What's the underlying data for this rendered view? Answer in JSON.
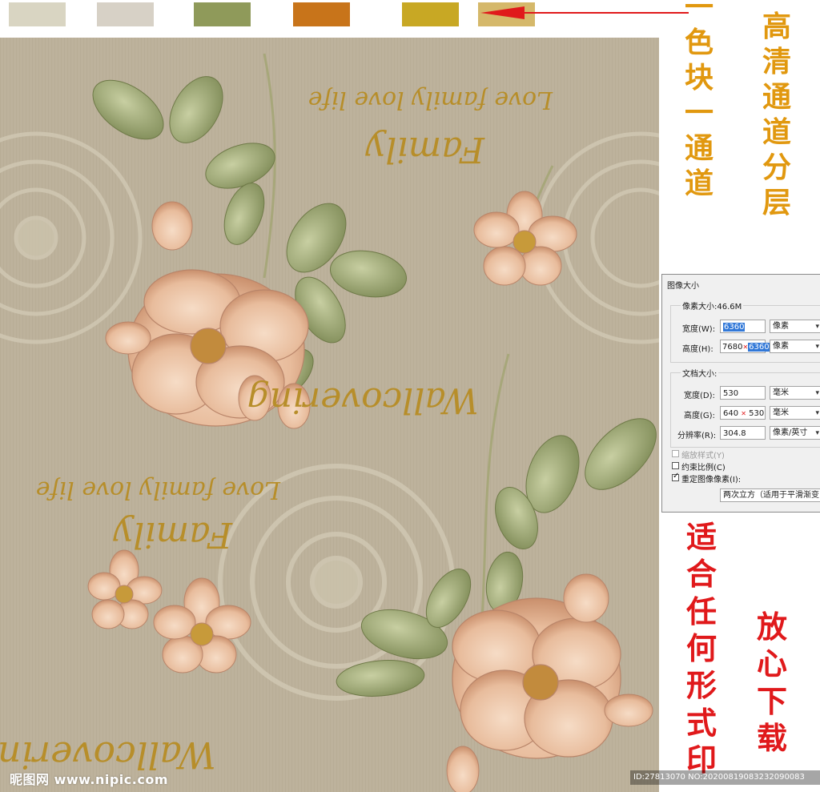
{
  "swatches": [
    {
      "color": "#d9d5c2"
    },
    {
      "color": "#d7d1c6"
    },
    {
      "color": "#8f9a5a"
    },
    {
      "color": "#c8741a"
    },
    {
      "color": "#c8a824"
    },
    {
      "color": "#d5b86a"
    }
  ],
  "colors": {
    "background_pattern": "#bdb29c",
    "lace": "#cfc7b2",
    "flower": "#ecc3a3",
    "leaf": "#8f9a64",
    "script_text": "#b78e2a",
    "orange_caption": "#e1980f",
    "red_caption": "#e0191b"
  },
  "captions": {
    "swatch_label": "一色块一通道",
    "channel_label": "高清通道分层",
    "print_label": "适合任何形式印",
    "download_label": "放心下载"
  },
  "pattern_text": {
    "family": "Family",
    "love_family": "Love family love life",
    "wallcovering": "Wallcovering"
  },
  "dialog": {
    "title": "图像大小",
    "pixel_size": "像素大小:46.6M",
    "width_label": "宽度(W):",
    "width_value": "6360",
    "width_unit": "像素",
    "height_label": "高度(H):",
    "height_old": "7680",
    "height_value": "6360",
    "height_unit": "像素",
    "doc_size": "文档大小:",
    "doc_width_label": "宽度(D):",
    "doc_width_value": "530",
    "doc_width_unit": "毫米",
    "doc_height_label": "高度(G):",
    "doc_height_old": "640",
    "doc_height_new": "530",
    "doc_height_unit": "毫米",
    "resolution_label": "分辨率(R):",
    "resolution_value": "304.8",
    "resolution_unit": "像素/英寸",
    "scale_styles": "缩放样式(Y)",
    "constrain": "约束比例(C)",
    "resample": "重定图像像素(I):",
    "resample_method": "两次立方（适用于平滑渐变"
  },
  "watermarks": {
    "site": "昵图网 www.nipic.com",
    "id": "ID:27813070 NO:20200819083232090083"
  }
}
